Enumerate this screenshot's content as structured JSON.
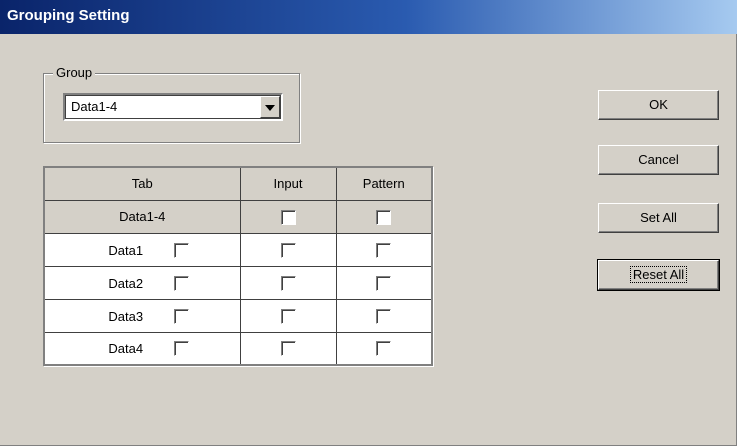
{
  "window": {
    "title": "Grouping Setting"
  },
  "group": {
    "legend": "Group",
    "selected": "Data1-4"
  },
  "grid": {
    "headers": {
      "tab": "Tab",
      "input": "Input",
      "pattern": "Pattern"
    },
    "group_row": {
      "label": "Data1-4",
      "input_checked": false,
      "pattern_checked": false
    },
    "rows": [
      {
        "label": "Data1",
        "tab_checked": false,
        "input_checked": false,
        "pattern_checked": false
      },
      {
        "label": "Data2",
        "tab_checked": false,
        "input_checked": false,
        "pattern_checked": false
      },
      {
        "label": "Data3",
        "tab_checked": false,
        "input_checked": false,
        "pattern_checked": false
      },
      {
        "label": "Data4",
        "tab_checked": false,
        "input_checked": false,
        "pattern_checked": false
      }
    ]
  },
  "buttons": {
    "ok": "OK",
    "cancel": "Cancel",
    "set_all": "Set All",
    "reset_all": "Reset All"
  }
}
